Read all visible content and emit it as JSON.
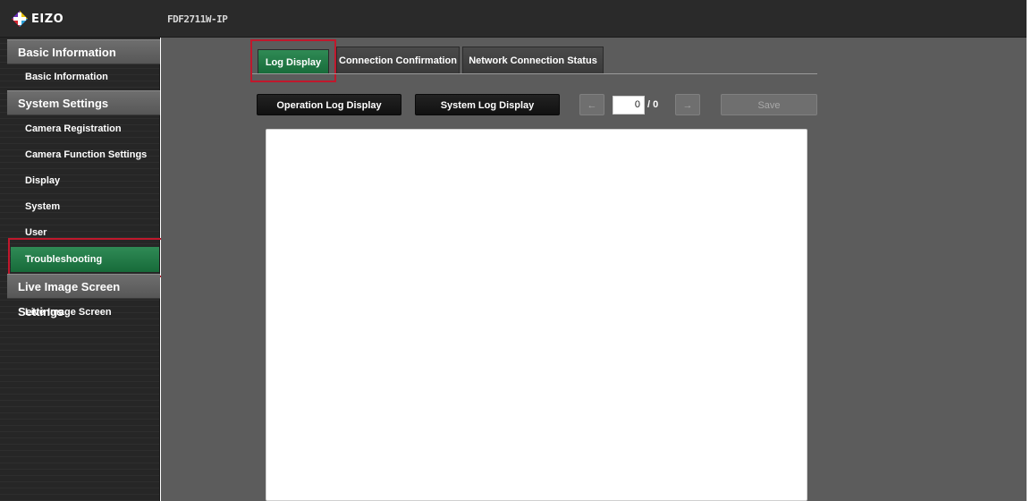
{
  "header": {
    "brand": "EIZO",
    "model_name": "FDF2711W-IP"
  },
  "sidebar": {
    "sections": [
      {
        "title": "Basic Information",
        "items": [
          {
            "label": "Basic Information"
          }
        ]
      },
      {
        "title": "System Settings",
        "items": [
          {
            "label": "Camera Registration"
          },
          {
            "label": "Camera Function Settings"
          },
          {
            "label": "Display"
          },
          {
            "label": "System"
          },
          {
            "label": "User"
          },
          {
            "label": "Troubleshooting",
            "active": true
          }
        ]
      },
      {
        "title": "Live Image Screen Settings",
        "items": [
          {
            "label": "Live Image Screen"
          }
        ]
      }
    ]
  },
  "tabs": [
    {
      "label": "Log Display",
      "active": true
    },
    {
      "label": "Connection Confirmation"
    },
    {
      "label": "Network Connection Status"
    }
  ],
  "toolbar": {
    "operation_log_label": "Operation Log Display",
    "system_log_label": "System Log Display",
    "prev_label": "←",
    "next_label": "→",
    "page_value": "0",
    "page_total": "/ 0",
    "save_label": "Save"
  },
  "colors": {
    "accent_green": "#1f7a45",
    "highlight_red": "#c0182c",
    "content_bg": "#5c5c5c",
    "sidebar_bg": "#262626"
  }
}
